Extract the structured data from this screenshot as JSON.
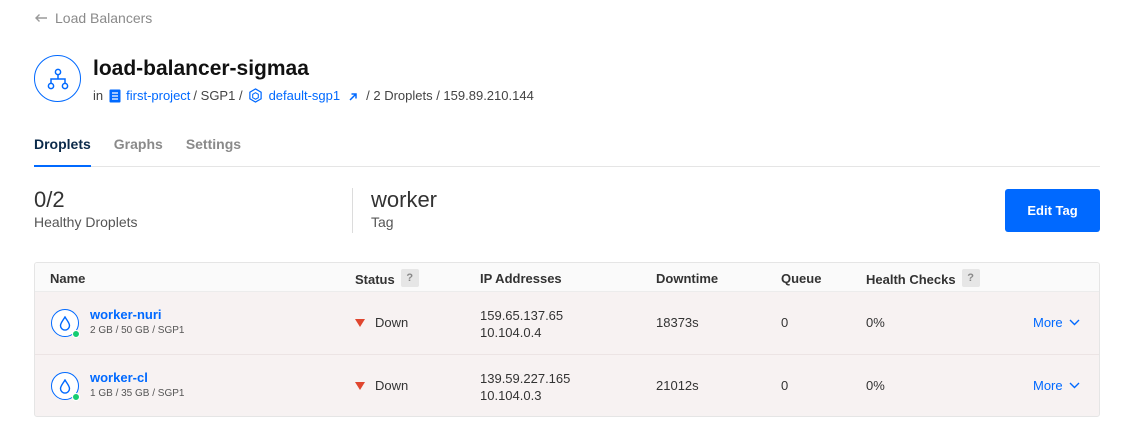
{
  "back_link": "Load Balancers",
  "title": "load-balancer-sigmaa",
  "meta": {
    "in": "in",
    "project": "first-project",
    "region": "/ SGP1 /",
    "vpc": "default-sgp1",
    "rest": "/ 2 Droplets / 159.89.210.144"
  },
  "tabs": [
    "Droplets",
    "Graphs",
    "Settings"
  ],
  "active_tab": "Droplets",
  "healthy": {
    "value": "0/2",
    "label": "Healthy Droplets"
  },
  "tag": {
    "value": "worker",
    "label": "Tag"
  },
  "edit_tag_button": "Edit Tag",
  "table": {
    "headers": {
      "name": "Name",
      "status": "Status",
      "ip": "IP Addresses",
      "downtime": "Downtime",
      "queue": "Queue",
      "health": "Health Checks"
    },
    "help_mark": "?",
    "rows": [
      {
        "name": "worker-nuri",
        "spec": "2 GB / 50 GB / SGP1",
        "status": "Down",
        "ip_public": "159.65.137.65",
        "ip_private": "10.104.0.4",
        "downtime": "18373s",
        "queue": "0",
        "health": "0%",
        "more": "More"
      },
      {
        "name": "worker-cl",
        "spec": "1 GB / 35 GB / SGP1",
        "status": "Down",
        "ip_public": "139.59.227.165",
        "ip_private": "10.104.0.3",
        "downtime": "21012s",
        "queue": "0",
        "health": "0%",
        "more": "More"
      }
    ]
  },
  "colors": {
    "accent": "#0069ff",
    "status_down": "#e0462f",
    "online_dot": "#15cd72"
  }
}
